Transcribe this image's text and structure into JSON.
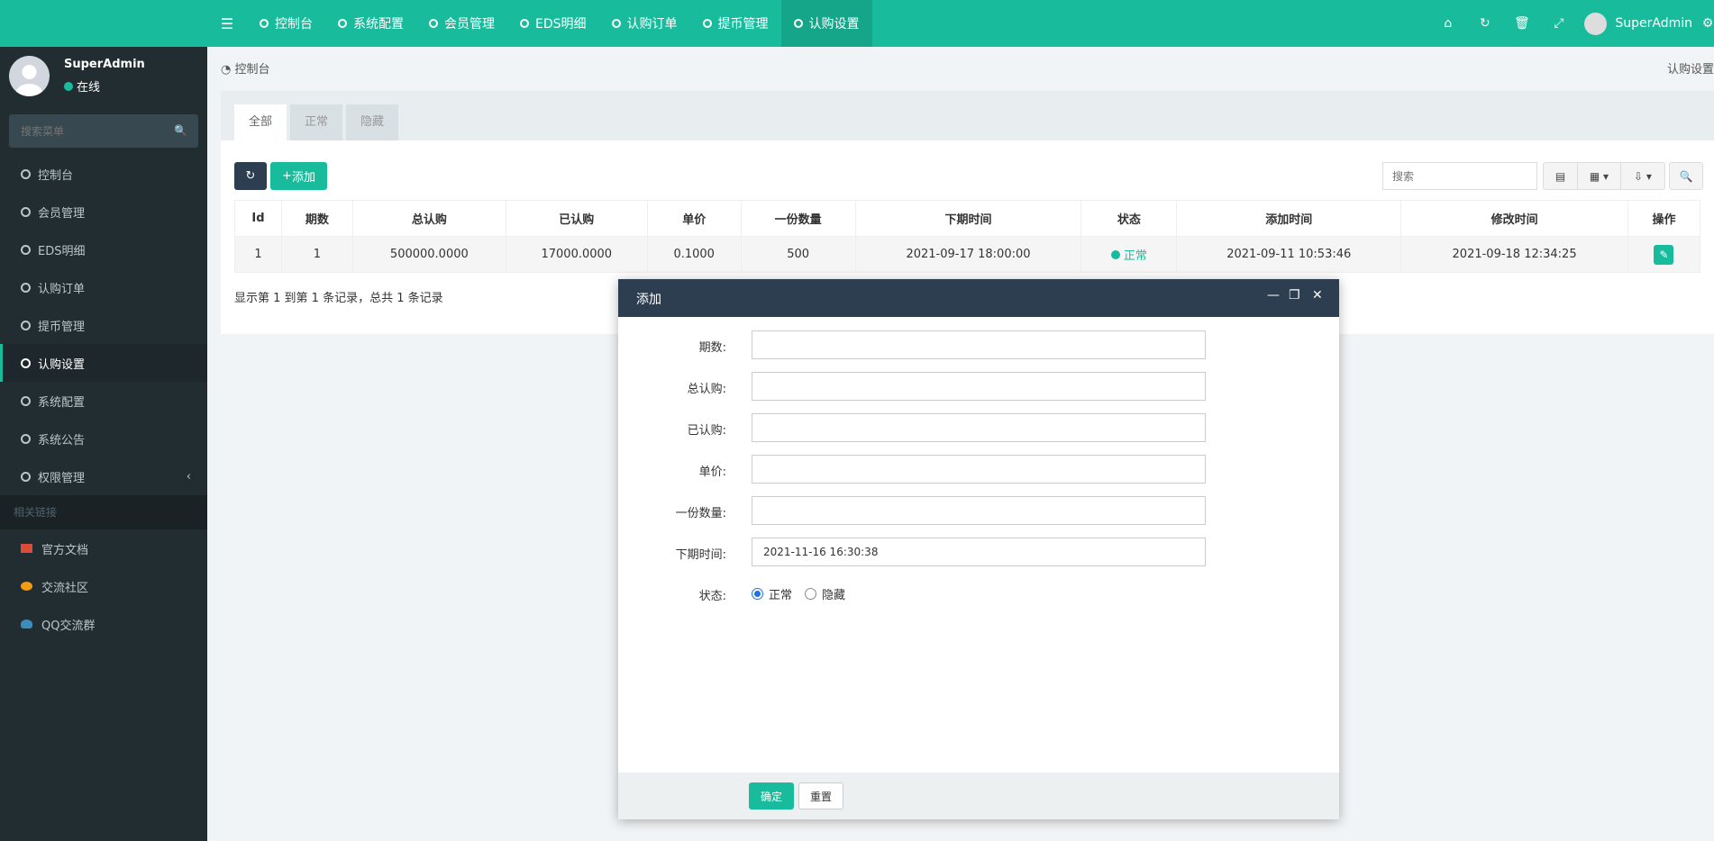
{
  "topnav": {
    "tabs": [
      "控制台",
      "系统配置",
      "会员管理",
      "EDS明细",
      "认购订单",
      "提币管理",
      "认购设置"
    ],
    "active_index": 6,
    "user": "SuperAdmin"
  },
  "sidebar": {
    "user": "SuperAdmin",
    "status": "在线",
    "search_placeholder": "搜索菜单",
    "items": [
      "控制台",
      "会员管理",
      "EDS明细",
      "认购订单",
      "提币管理",
      "认购设置",
      "系统配置",
      "系统公告",
      "权限管理"
    ],
    "active_index": 5,
    "links_header": "相关链接",
    "links": [
      {
        "label": "官方文档",
        "color": "#dd4b39"
      },
      {
        "label": "交流社区",
        "color": "#f39c12"
      },
      {
        "label": "QQ交流群",
        "color": "#3c8dbc"
      }
    ]
  },
  "breadcrumb": {
    "home": "控制台",
    "current": "认购设置"
  },
  "panel": {
    "tabs": [
      "全部",
      "正常",
      "隐藏"
    ],
    "add_label": "添加",
    "search_placeholder": "搜索",
    "columns": [
      "Id",
      "期数",
      "总认购",
      "已认购",
      "单价",
      "一份数量",
      "下期时间",
      "状态",
      "添加时间",
      "修改时间",
      "操作"
    ],
    "row": {
      "id": "1",
      "period": "1",
      "total": "500000.0000",
      "subscribed": "17000.0000",
      "price": "0.1000",
      "qty": "500",
      "next_time": "2021-09-17 18:00:00",
      "status": "正常",
      "added": "2021-09-11 10:53:46",
      "modified": "2021-09-18 12:34:25"
    },
    "page_info": "显示第 1 到第 1 条记录，总共 1 条记录"
  },
  "modal": {
    "title": "添加",
    "fields": {
      "period": "期数:",
      "total": "总认购:",
      "subscribed": "已认购:",
      "price": "单价:",
      "qty": "一份数量:",
      "next_time": "下期时间:",
      "status": "状态:"
    },
    "next_time_value": "2021-11-16 16:30:38",
    "status_on": "正常",
    "status_off": "隐藏",
    "ok": "确定",
    "reset": "重置"
  },
  "colors": {
    "primary": "#18bc9c",
    "sidebar": "#222d32",
    "modal_title": "#2c3e50"
  }
}
